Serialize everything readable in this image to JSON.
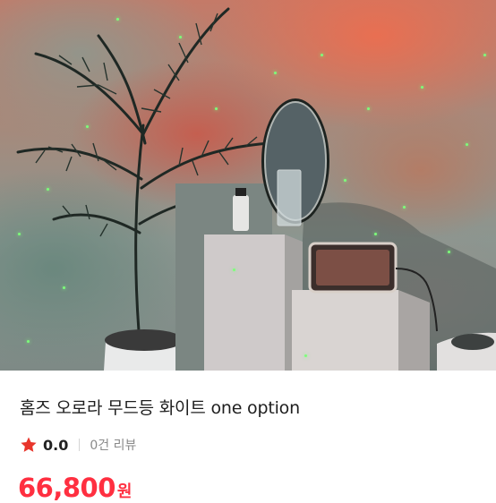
{
  "product": {
    "title": "홈즈 오로라 무드등 화이트 one option",
    "rating": "0.0",
    "review_count": "0건 리뷰",
    "price": "66,800",
    "price_unit": "원",
    "icons": {
      "rating_star": "star-icon"
    },
    "colors": {
      "accent": "#ff2f40",
      "star": "#e8352b"
    }
  }
}
